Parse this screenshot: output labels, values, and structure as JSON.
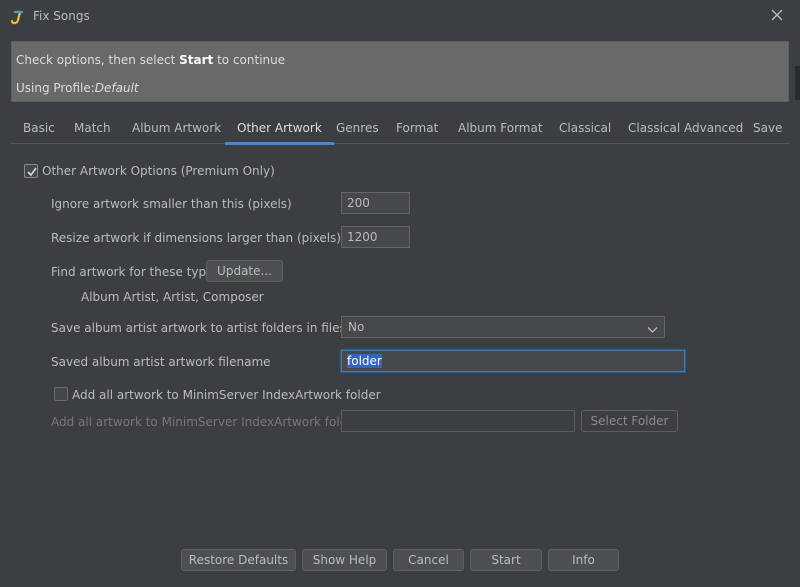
{
  "window": {
    "title": "Fix Songs",
    "app_icon": "jaikoz-logo-icon",
    "close_icon": "close-icon"
  },
  "header": {
    "instruction_prefix": "Check options, then select ",
    "instruction_bold": "Start",
    "instruction_suffix": " to continue",
    "profile_prefix": "Using Profile:",
    "profile_name": "Default"
  },
  "tabs": [
    {
      "label": "Basic"
    },
    {
      "label": "Match"
    },
    {
      "label": "Album Artwork"
    },
    {
      "label": "Other Artwork",
      "active": true
    },
    {
      "label": "Genres"
    },
    {
      "label": "Format"
    },
    {
      "label": "Album Format"
    },
    {
      "label": "Classical"
    },
    {
      "label": "Classical Advanced"
    },
    {
      "label": "Save"
    }
  ],
  "options": {
    "enable_label": "Other Artwork Options (Premium Only)",
    "enable_checked": true,
    "ignore_smaller_label": "Ignore artwork smaller than this (pixels)",
    "ignore_smaller_value": "200",
    "resize_label": "Resize artwork if dimensions larger than (pixels)",
    "resize_value": "1200",
    "find_types_label": "Find artwork for these types:",
    "update_button": "Update...",
    "types_list": "Album Artist, Artist, Composer",
    "save_to_folders_label": "Save album artist artwork to artist folders in filesystem",
    "save_to_folders_value": "No",
    "saved_filename_label": "Saved album artist artwork filename",
    "saved_filename_value": "folder",
    "add_minim_checkbox_label": "Add all artwork to MinimServer IndexArtwork folder",
    "add_minim_checked": false,
    "add_minim_folder_label": "Add all artwork to MinimServer IndexArtwork folder",
    "add_minim_folder_value": "",
    "select_folder_button": "Select Folder"
  },
  "footer": {
    "restore_defaults": "Restore Defaults",
    "show_help": "Show Help",
    "cancel": "Cancel",
    "start": "Start",
    "info": "Info"
  }
}
